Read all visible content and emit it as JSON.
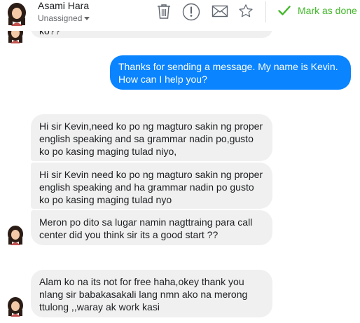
{
  "header": {
    "contact_name": "Asami Hara",
    "assign_label": "Unassigned",
    "mark_done_label": "Mark as done",
    "tools": [
      "trash-icon",
      "exclamation-icon",
      "envelope-icon",
      "star-icon"
    ],
    "accent_color": "#42b72a"
  },
  "messages": [
    {
      "from": "contact",
      "text": "ko??"
    },
    {
      "from": "agent",
      "text": "Thanks for sending a message. My name is Kevin. How can I help you?"
    },
    {
      "from": "contact",
      "text": "Hi sir Kevin,need ko po ng magturo sakin ng proper english speaking and sa grammar nadin po,gusto ko po kasing maging tulad niyo,"
    },
    {
      "from": "contact",
      "text": "Hi sir Kevin need ko po ng magturo sakin ng proper english speaking and ha grammar nadin po gusto ko po kasing maging tulad nyo"
    },
    {
      "from": "contact",
      "text": "Meron po dito sa lugar namin nagttraing para call center did you think sir its a good start ??"
    },
    {
      "from": "contact",
      "text": "Alam ko na its not for free haha,okey thank you nlang sir babakasakali lang nmn ako na merong ttulong ,,waray ak work kasi"
    }
  ],
  "colors": {
    "outgoing_bubble": "#0a84ff",
    "incoming_bubble": "#f0f0f0"
  }
}
